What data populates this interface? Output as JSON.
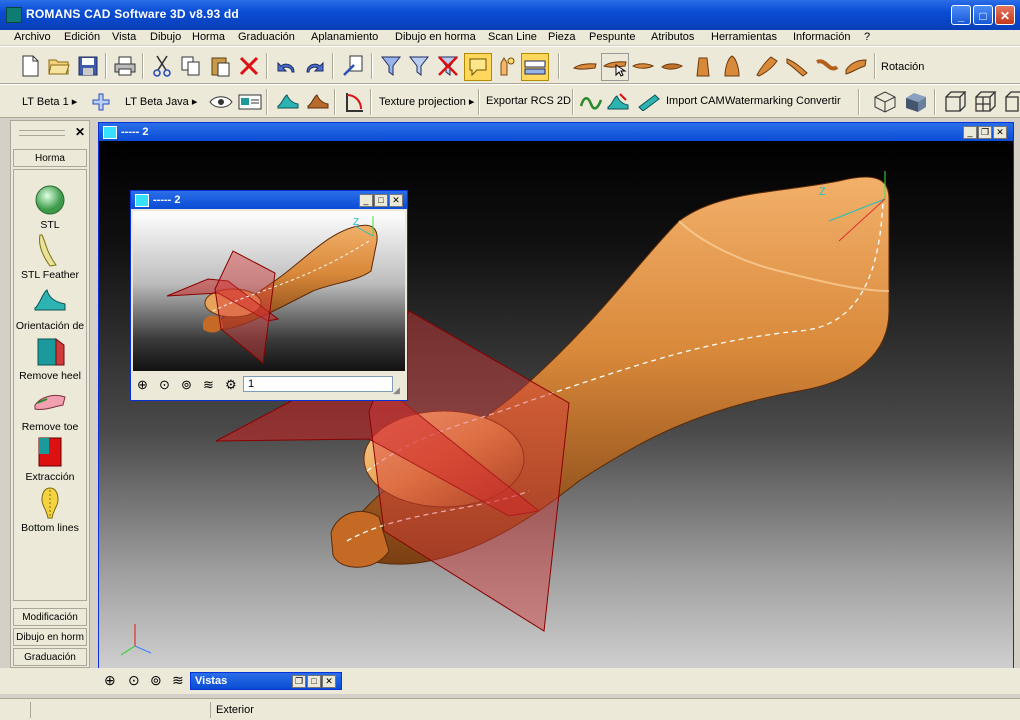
{
  "window": {
    "title": "ROMANS CAD Software 3D v8.93 dd"
  },
  "menu": [
    "Archivo",
    "Edición",
    "Vista",
    "Dibujo",
    "Horma",
    "Graduación",
    "Aplanamiento",
    "Dibujo en horma",
    "Scan Line",
    "Pieza",
    "Pespunte",
    "Atributos",
    "Herramientas",
    "Información",
    "?"
  ],
  "toolbar1": {
    "rotation_label": "Rotación"
  },
  "toolbar2": {
    "lt_beta_1": "LT Beta 1",
    "lt_beta_java": "LT Beta Java",
    "texture_projection": "Texture projection",
    "export_rcs": "Exportar RCS 2D",
    "import_cam": "Import CAM",
    "watermarking": "Watermarking",
    "convertir": "Convertir"
  },
  "left_panel": {
    "active_tab": "Horma",
    "items": [
      "STL",
      "STL Feather",
      "Orientación de",
      "Remove heel",
      "Remove toe",
      "Extracción",
      "Bottom lines"
    ],
    "bottom_tabs": [
      "Modificación",
      "Dibujo en horm",
      "Graduación"
    ]
  },
  "main_window": {
    "title": "----- 2"
  },
  "inner_window": {
    "title": "----- 2",
    "page_value": "1"
  },
  "vistas": {
    "title": "Vistas"
  },
  "status": {
    "text": "Exterior"
  },
  "axes": {
    "z": "Z"
  },
  "colors": {
    "titlebar": "#0a4cd4",
    "last": "#d9893a",
    "plane": "#cc1f1f",
    "chrome": "#ece9d8"
  }
}
